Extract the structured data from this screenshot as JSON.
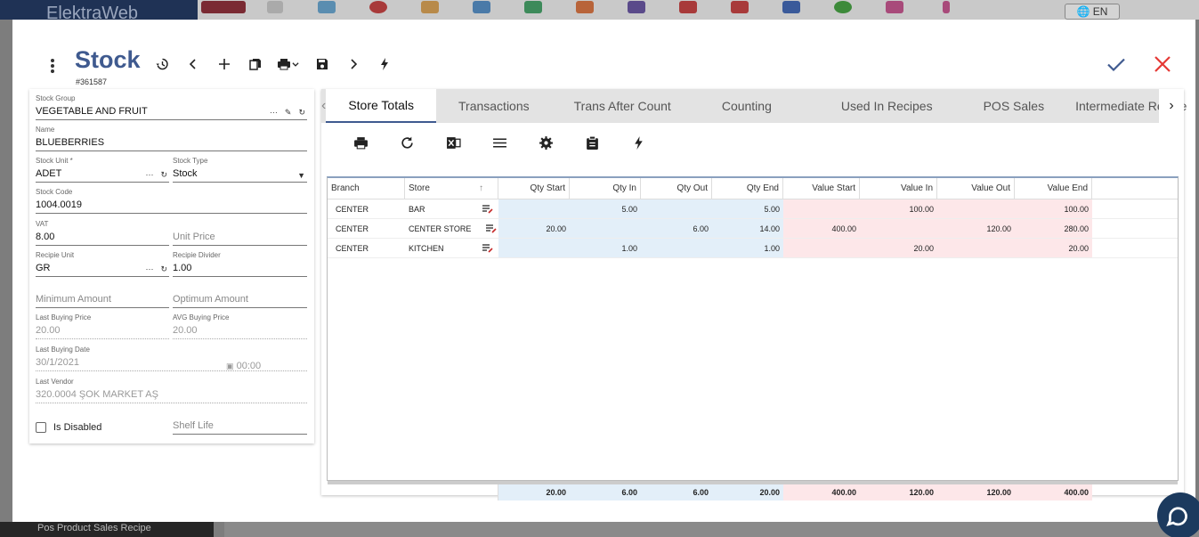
{
  "app": {
    "brand": "ElektraWeb",
    "lang": "EN"
  },
  "sidebar": {
    "bottom_item": "Pos Product Sales Recipe"
  },
  "header": {
    "title": "Stock",
    "record_id": "#361587"
  },
  "colors": {
    "accent": "#3f5a8f",
    "ok": "#3f5a8f",
    "close": "#e53935",
    "qty_bg": "#e3eff9",
    "value_bg": "#fde7e9"
  },
  "form": {
    "stock_group": {
      "label": "Stock Group",
      "value": "VEGETABLE AND FRUIT"
    },
    "name": {
      "label": "Name",
      "value": "BLUEBERRIES"
    },
    "stock_unit": {
      "label": "Stock Unit *",
      "value": "ADET"
    },
    "stock_type": {
      "label": "Stock Type",
      "value": "Stock"
    },
    "stock_code": {
      "label": "Stock Code",
      "value": "1004.0019"
    },
    "vat": {
      "label": "VAT",
      "value": "8.00"
    },
    "unit_price": {
      "placeholder": "Unit Price"
    },
    "recipe_unit": {
      "label": "Recipie Unit",
      "value": "GR"
    },
    "recipe_divider": {
      "label": "Recipie Divider",
      "value": "1.00"
    },
    "minimum_amount": {
      "placeholder": "Minimum Amount"
    },
    "optimum_amount": {
      "placeholder": "Optimum Amount"
    },
    "last_buying_price": {
      "label": "Last Buying Price",
      "value": "20.00"
    },
    "avg_buying_price": {
      "label": "AVG Buying Price",
      "value": "20.00"
    },
    "last_buying_date": {
      "label": "Last Buying Date",
      "value": "30/1/2021",
      "time": "00:00"
    },
    "last_vendor": {
      "label": "Last Vendor",
      "value": "320.0004 ŞOK MARKET AŞ"
    },
    "is_disabled": {
      "label": "Is Disabled"
    },
    "shelf_life": {
      "placeholder": "Shelf Life"
    },
    "dots": "···"
  },
  "tabs": [
    "Store Totals",
    "Transactions",
    "Trans After Count",
    "Counting",
    "Used In Recipes",
    "POS Sales",
    "Intermediate Recipe"
  ],
  "grid": {
    "columns": [
      "Branch",
      "Store",
      "Qty Start",
      "Qty In",
      "Qty Out",
      "Qty End",
      "Value Start",
      "Value In",
      "Value Out",
      "Value End"
    ],
    "rows": [
      {
        "branch": "CENTER",
        "store": "BAR",
        "qty_start": "",
        "qty_in": "5.00",
        "qty_out": "",
        "qty_end": "5.00",
        "value_start": "",
        "value_in": "100.00",
        "value_out": "",
        "value_end": "100.00"
      },
      {
        "branch": "CENTER",
        "store": "CENTER STORE",
        "qty_start": "20.00",
        "qty_in": "",
        "qty_out": "6.00",
        "qty_end": "14.00",
        "value_start": "400.00",
        "value_in": "",
        "value_out": "120.00",
        "value_end": "280.00"
      },
      {
        "branch": "CENTER",
        "store": "KITCHEN",
        "qty_start": "",
        "qty_in": "1.00",
        "qty_out": "",
        "qty_end": "1.00",
        "value_start": "",
        "value_in": "20.00",
        "value_out": "",
        "value_end": "20.00"
      }
    ],
    "totals": {
      "qty_start": "20.00",
      "qty_in": "6.00",
      "qty_out": "6.00",
      "qty_end": "20.00",
      "value_start": "400.00",
      "value_in": "120.00",
      "value_out": "120.00",
      "value_end": "400.00"
    }
  }
}
